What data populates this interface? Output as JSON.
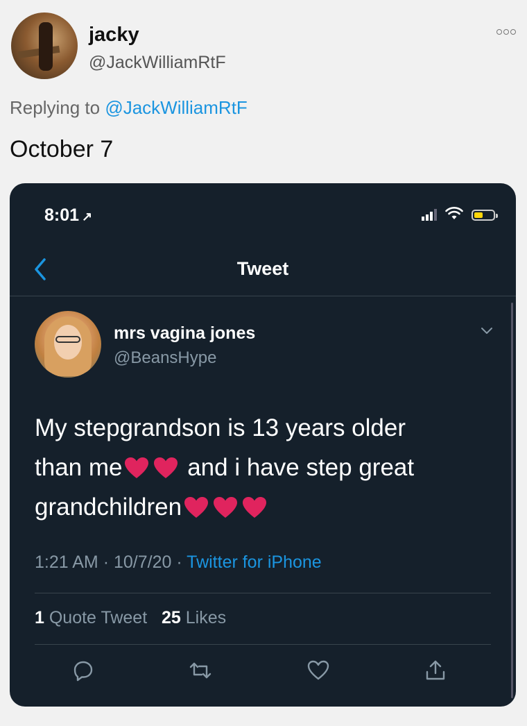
{
  "reply": {
    "author_name": "jacky",
    "author_handle": "@JackWilliamRtF",
    "replying_prefix": "Replying to",
    "replying_to": "@JackWilliamRtF",
    "text": "October 7"
  },
  "screenshot": {
    "status_time": "8:01",
    "status_arrow": "↗",
    "nav_title": "Tweet",
    "tweet": {
      "author_name": "mrs vagina jones",
      "author_handle": "@BeansHype",
      "line1": "My stepgrandson is 13 years older",
      "line2_a": "than me",
      "line2_b": "and i have step great",
      "line3": "grandchildren",
      "time": "1:21 AM",
      "date": "10/7/20",
      "separator": "·",
      "source": "Twitter for iPhone",
      "quote_count": "1",
      "quote_label": "Quote Tweet",
      "likes_count": "25",
      "likes_label": "Likes"
    },
    "colors": {
      "background": "#15202b",
      "link": "#1b95e0",
      "heart": "#e0245e",
      "muted": "#8899a6"
    }
  },
  "icons": {
    "more": "more-icon",
    "back": "chevron-left-icon",
    "caret": "chevron-down-icon",
    "reply": "reply-icon",
    "retweet": "retweet-icon",
    "like": "heart-icon",
    "share": "share-icon"
  }
}
